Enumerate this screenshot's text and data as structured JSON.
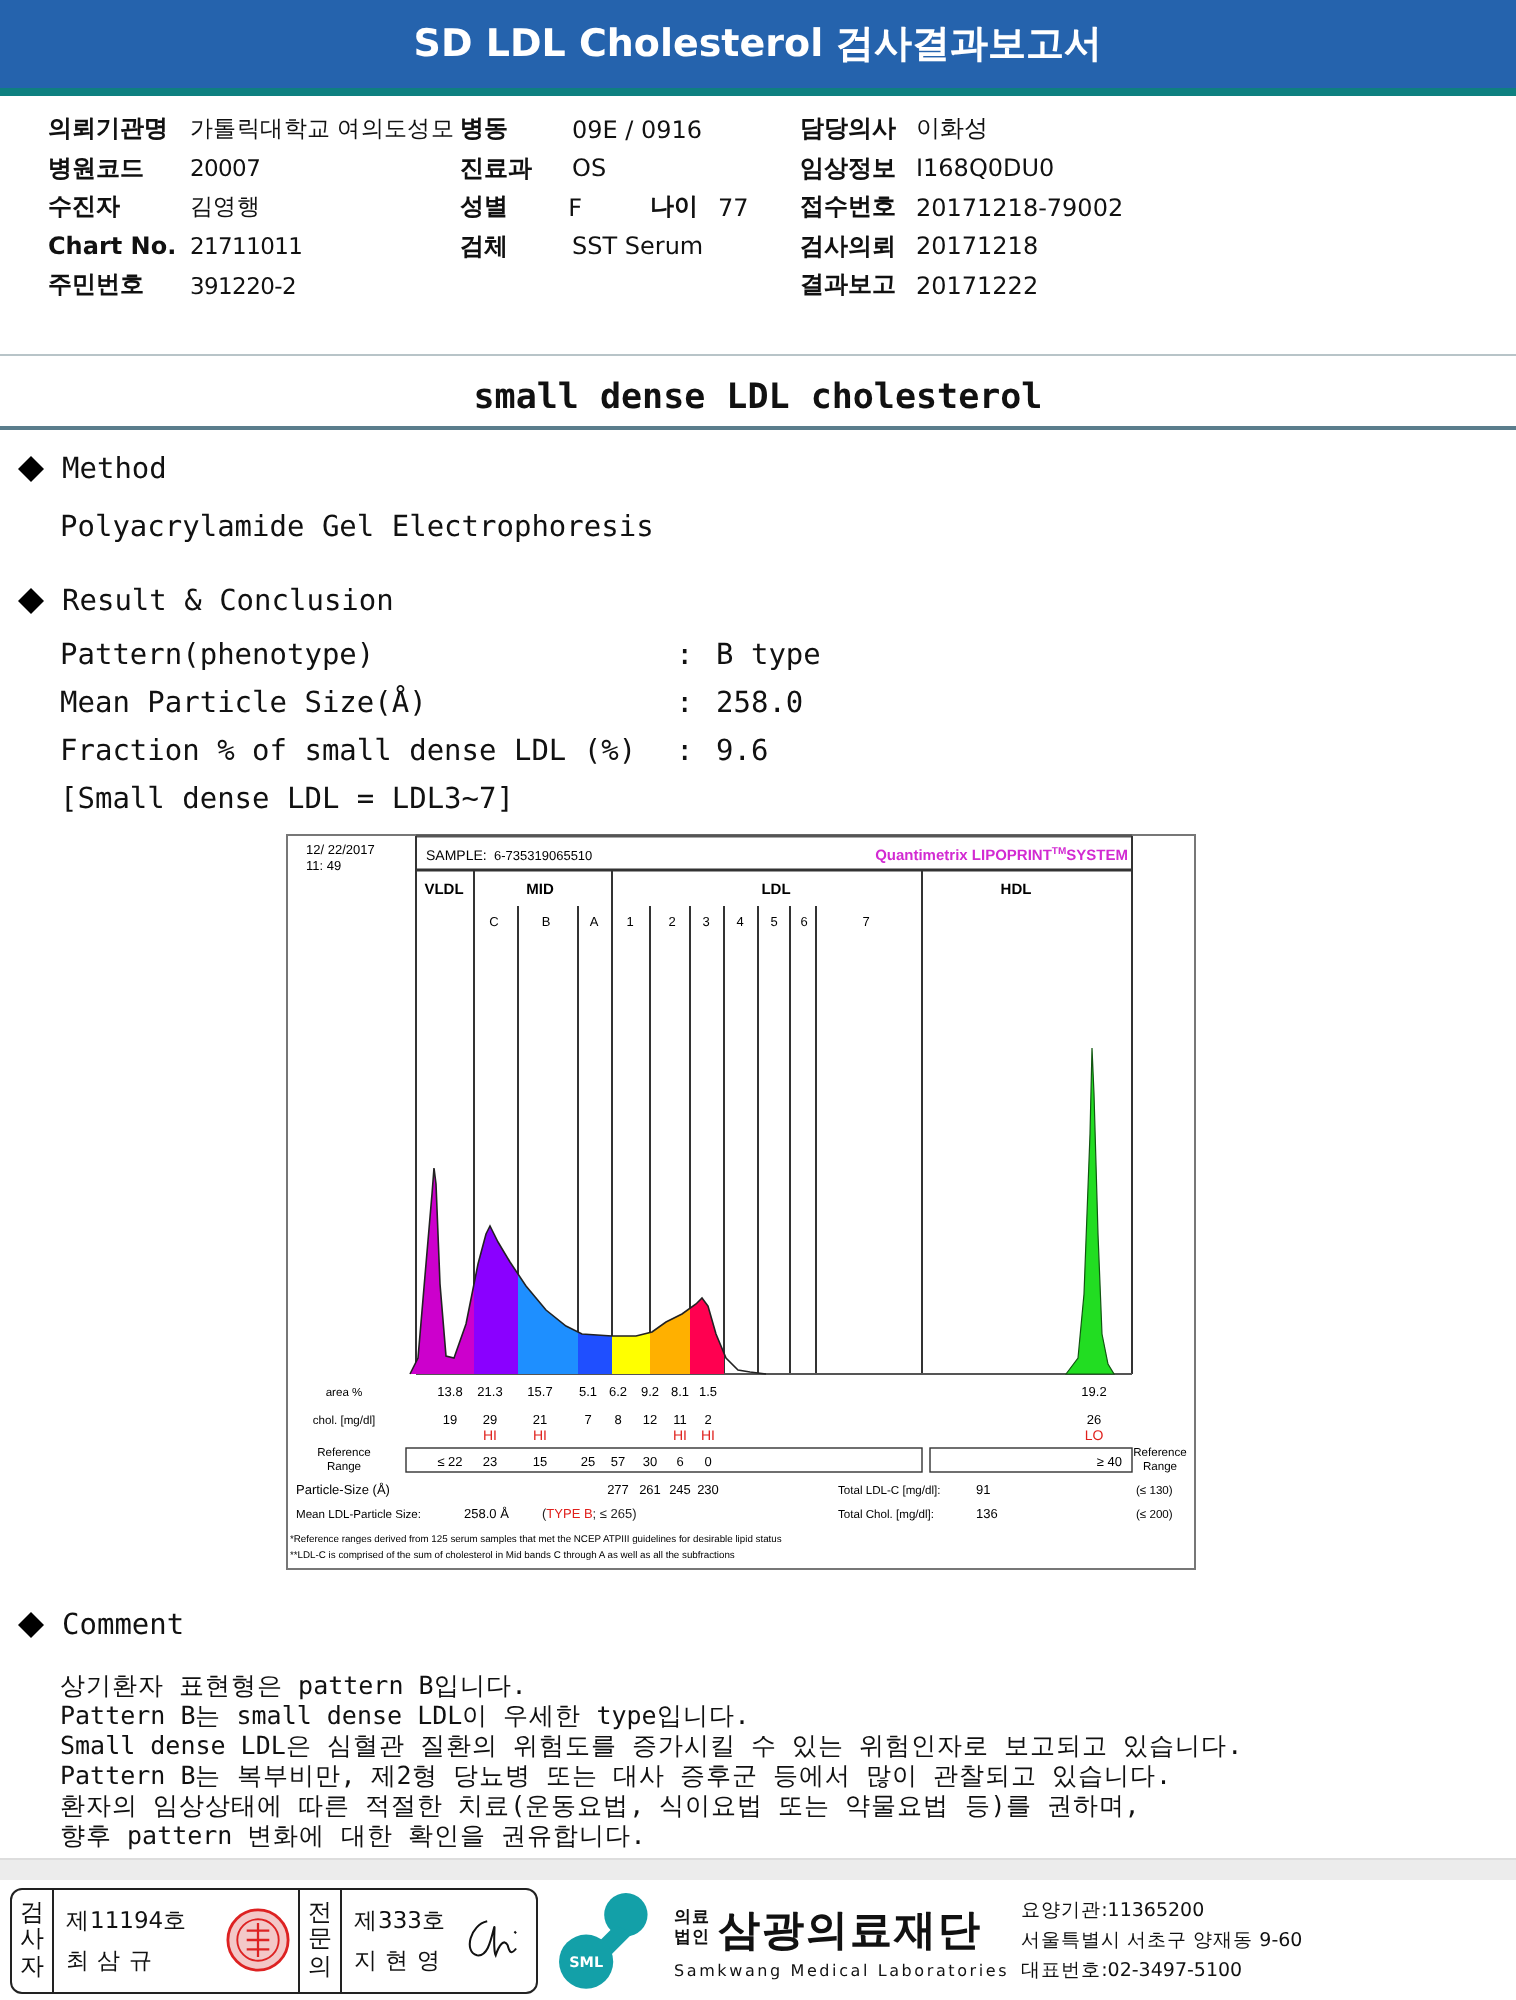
{
  "title": "SD LDL Cholesterol 검사결과보고서",
  "patient_info": [
    {
      "left": {
        "label": "의뢰기관명",
        "value": "가톨릭대학교 여의도성모"
      },
      "middle": [
        {
          "label": "병동",
          "value": "09E / 0916"
        }
      ],
      "right": {
        "label": "담당의사",
        "value": "이화성"
      }
    },
    {
      "left": {
        "label": "병원코드",
        "value": "20007"
      },
      "middle": [
        {
          "label": "진료과",
          "value": "OS"
        }
      ],
      "right": {
        "label": "임상정보",
        "value": "I168Q0DU0"
      }
    },
    {
      "left": {
        "label": "수진자",
        "value": "김영행"
      },
      "middle": [
        {
          "label": "성별",
          "value": "F"
        },
        {
          "label": "나이",
          "value": "77"
        }
      ],
      "right": {
        "label": "접수번호",
        "value": "20171218-79002"
      }
    },
    {
      "left": {
        "label": "Chart No.",
        "value": "21711011"
      },
      "middle": [
        {
          "label": "검체",
          "value": "SST Serum"
        }
      ],
      "right": {
        "label": "검사의뢰",
        "value": "20171218"
      }
    },
    {
      "left": {
        "label": "주민번호",
        "value": "391220-2"
      },
      "right": {
        "label": "결과보고",
        "value": "20171222"
      }
    }
  ],
  "report_title": "small dense LDL cholesterol",
  "sections": [
    {
      "kind": "text",
      "heading": "Method",
      "lines": [
        "Polyacrylamide Gel Electrophoresis"
      ]
    },
    {
      "kind": "results",
      "heading": "Result & Conclusion",
      "results": [
        {
          "label": "Pattern(phenotype)",
          "separator": ":",
          "value": "B type"
        },
        {
          "label": "Mean Particle Size(Å)",
          "separator": ":",
          "value": "258.0"
        },
        {
          "label": "Fraction % of small dense LDL (%)",
          "separator": ":",
          "value": "9.6"
        }
      ],
      "note": "[Small dense LDL = LDL3~7]",
      "electropherogram": {
        "date": "12/ 22/2017",
        "time": "11: 49",
        "sample_label": "SAMPLE:",
        "sample_id": "6-735319065510",
        "system": "Quantimetrix LIPOPRINT",
        "system_mark": "TM",
        "system_suffix": "SYSTEM",
        "groups": [
          "VLDL",
          "MID",
          "LDL",
          "HDL"
        ],
        "bands": [
          "C",
          "B",
          "A",
          "1",
          "2",
          "3",
          "4",
          "5",
          "6",
          "7"
        ],
        "row_labels": {
          "area": "area %",
          "chol": "chol. [mg/dl]",
          "reference": [
            "Reference",
            "Range"
          ],
          "size": "Particle-Size (Å)"
        },
        "fractions": [
          {
            "area": "13.8",
            "chol": "19",
            "reference": "≤ 22"
          },
          {
            "area": "21.3",
            "chol": "29",
            "flag": "HI",
            "reference": "23"
          },
          {
            "area": "15.7",
            "chol": "21",
            "flag": "HI",
            "reference": "15"
          },
          {
            "area": "5.1",
            "chol": "7",
            "reference": "25"
          },
          {
            "area": "6.2",
            "chol": "8",
            "reference": "57",
            "size": "277"
          },
          {
            "area": "9.2",
            "chol": "12",
            "reference": "30",
            "size": "261"
          },
          {
            "area": "8.1",
            "chol": "11",
            "flag": "HI",
            "reference": "6",
            "size": "245"
          },
          {
            "area": "1.5",
            "chol": "2",
            "flag": "HI",
            "reference": "0",
            "size": "230"
          },
          {
            "area": "19.2",
            "chol": "26",
            "flag": "LO",
            "reference": "≥ 40"
          }
        ],
        "reference_right": [
          "Reference",
          "Range"
        ],
        "mean_size": {
          "label": "Mean LDL-Particle Size:",
          "value": "258.0 Å",
          "qualifier": [
            {
              "text": "(",
              "flag": false
            },
            {
              "text": "TYPE B",
              "flag": true
            },
            {
              "text": "; ≤ 265)",
              "flag": false
            }
          ]
        },
        "totals": [
          {
            "label": "Total LDL-C [mg/dl]:",
            "value": "91",
            "limit": "(≤ 130)"
          },
          {
            "label": "Total Chol. [mg/dl]:",
            "value": "136",
            "limit": "(≤ 200)"
          }
        ],
        "footnotes": [
          "*Reference ranges derived from 125 serum samples that met the NCEP ATPIII guidelines for desirable lipid status",
          "**LDL-C is comprised of the sum of cholesterol in Mid bands C through A as well as all the subfractions"
        ]
      }
    },
    {
      "kind": "text",
      "heading": "Comment",
      "lines": [
        "상기환자 표현형은 pattern B입니다.",
        "Pattern B는 small dense LDL이 우세한 type입니다.",
        "Small dense LDL은 심혈관 질환의 위험도를 증가시킬 수 있는 위험인자로 보고되고 있습니다.",
        "Pattern B는 복부비만, 제2형 당뇨병 또는 대사 증후군 등에서 많이 관찰되고 있습니다.",
        "환자의 임상상태에 따른 적절한 치료(운동요법, 식이요법 또는 약물요법 등)를 권하며,",
        "향후 pattern 변화에 대한 확인을 권유합니다."
      ]
    }
  ],
  "signatures": [
    {
      "role": "검사자",
      "license": "제11194호",
      "name": "최 삼 규",
      "kind": "seal"
    },
    {
      "role": "전문의",
      "license": "제333호",
      "name": "지 현 영",
      "kind": "signature"
    }
  ],
  "lab": {
    "logo_text": "SML",
    "corp_type": [
      "의료",
      "법인"
    ],
    "name": "삼광의료재단",
    "english_name": "Samkwang Medical Laboratories",
    "contacts": [
      "요양기관:11365200",
      "서울특별시 서초구 양재동 9-60",
      "대표번호:02-3497-5100"
    ]
  }
}
